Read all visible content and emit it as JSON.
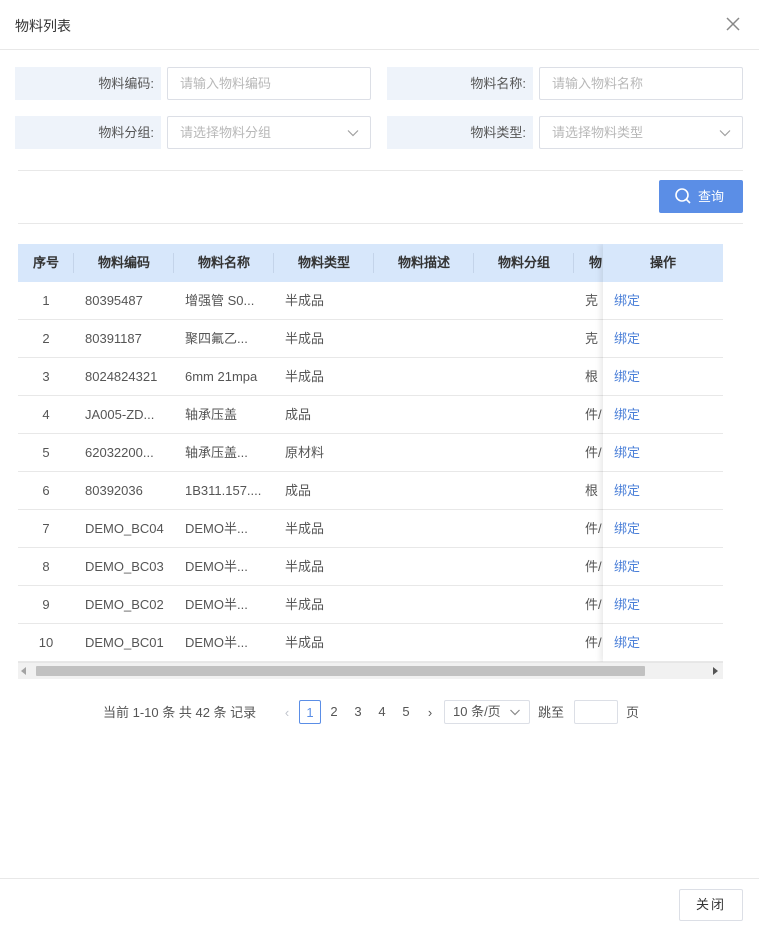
{
  "dialog": {
    "title": "物料列表",
    "close_icon": "close-icon"
  },
  "filters": {
    "code": {
      "label": "物料编码:",
      "placeholder": "请输入物料编码",
      "value": ""
    },
    "name": {
      "label": "物料名称:",
      "placeholder": "请输入物料名称",
      "value": ""
    },
    "group": {
      "label": "物料分组:",
      "placeholder": "请选择物料分组",
      "value": ""
    },
    "type": {
      "label": "物料类型:",
      "placeholder": "请选择物料类型",
      "value": ""
    }
  },
  "query_button": {
    "label": "查询",
    "icon": "search-icon"
  },
  "table": {
    "columns": [
      "序号",
      "物料编码",
      "物料名称",
      "物料类型",
      "物料描述",
      "物料分组",
      "物"
    ],
    "action_column": "操作",
    "action_label": "绑定",
    "rows": [
      {
        "idx": "1",
        "code": "80395487",
        "name": "增强管 S0...",
        "type": "半成品",
        "desc": "",
        "group": "",
        "unit": "克"
      },
      {
        "idx": "2",
        "code": "80391187",
        "name": "聚四氟乙...",
        "type": "半成品",
        "desc": "",
        "group": "",
        "unit": "克"
      },
      {
        "idx": "3",
        "code": "8024824321",
        "name": "6mm 21mpa",
        "type": "半成品",
        "desc": "",
        "group": "",
        "unit": "根"
      },
      {
        "idx": "4",
        "code": "JA005-ZD...",
        "name": "轴承压盖",
        "type": "成品",
        "desc": "",
        "group": "",
        "unit": "件/"
      },
      {
        "idx": "5",
        "code": "62032200...",
        "name": "轴承压盖...",
        "type": "原材料",
        "desc": "",
        "group": "",
        "unit": "件/"
      },
      {
        "idx": "6",
        "code": "80392036",
        "name": "1B311.157....",
        "type": "成品",
        "desc": "",
        "group": "",
        "unit": "根"
      },
      {
        "idx": "7",
        "code": "DEMO_BC04",
        "name": "DEMO半...",
        "type": "半成品",
        "desc": "",
        "group": "",
        "unit": "件/"
      },
      {
        "idx": "8",
        "code": "DEMO_BC03",
        "name": "DEMO半...",
        "type": "半成品",
        "desc": "",
        "group": "",
        "unit": "件/"
      },
      {
        "idx": "9",
        "code": "DEMO_BC02",
        "name": "DEMO半...",
        "type": "半成品",
        "desc": "",
        "group": "",
        "unit": "件/"
      },
      {
        "idx": "10",
        "code": "DEMO_BC01",
        "name": "DEMO半...",
        "type": "半成品",
        "desc": "",
        "group": "",
        "unit": "件/"
      }
    ]
  },
  "pagination": {
    "total_text": "当前 1-10 条 共 42 条 记录",
    "pages": [
      "1",
      "2",
      "3",
      "4",
      "5"
    ],
    "current_page": "1",
    "page_size": "10 条/页",
    "jump_label": "跳至",
    "jump_value": "",
    "page_suffix": "页"
  },
  "footer": {
    "close_label": "关闭"
  },
  "colors": {
    "accent": "#5b8ee6",
    "header_bg": "#d7e7fb",
    "label_bg": "#eef3fa",
    "link": "#4a7fd8"
  }
}
